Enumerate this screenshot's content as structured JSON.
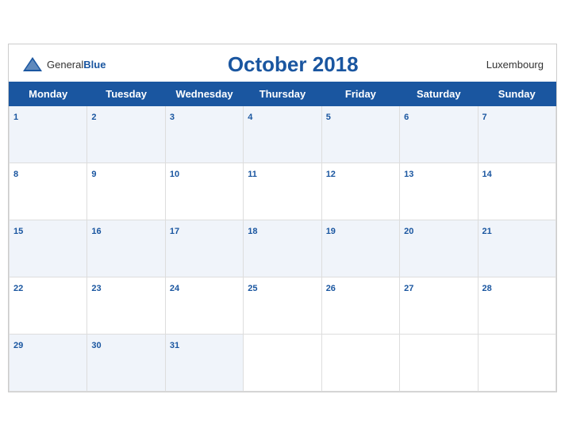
{
  "header": {
    "title": "October 2018",
    "country": "Luxembourg",
    "logo_general": "General",
    "logo_blue": "Blue"
  },
  "weekdays": [
    "Monday",
    "Tuesday",
    "Wednesday",
    "Thursday",
    "Friday",
    "Saturday",
    "Sunday"
  ],
  "weeks": [
    [
      1,
      2,
      3,
      4,
      5,
      6,
      7
    ],
    [
      8,
      9,
      10,
      11,
      12,
      13,
      14
    ],
    [
      15,
      16,
      17,
      18,
      19,
      20,
      21
    ],
    [
      22,
      23,
      24,
      25,
      26,
      27,
      28
    ],
    [
      29,
      30,
      31,
      null,
      null,
      null,
      null
    ]
  ]
}
